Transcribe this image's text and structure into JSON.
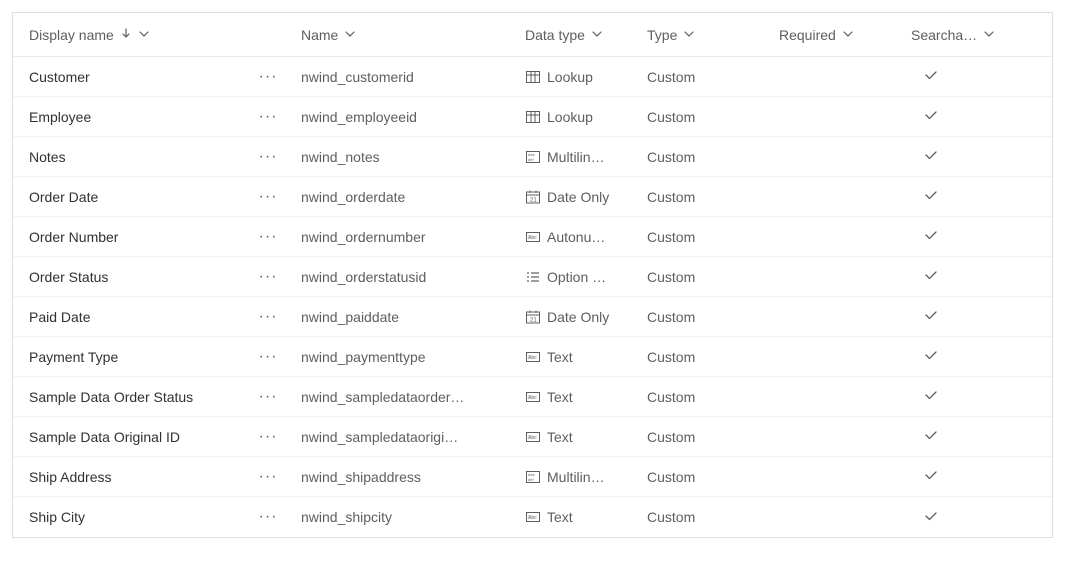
{
  "headers": {
    "display_name": "Display name",
    "name": "Name",
    "data_type": "Data type",
    "type": "Type",
    "required": "Required",
    "searchable": "Searcha…"
  },
  "icons": {
    "more": "···"
  },
  "rows": [
    {
      "display": "Customer",
      "name": "nwind_customerid",
      "datatype_icon": "lookup",
      "datatype": "Lookup",
      "type": "Custom",
      "required": "",
      "searchable": true
    },
    {
      "display": "Employee",
      "name": "nwind_employeeid",
      "datatype_icon": "lookup",
      "datatype": "Lookup",
      "type": "Custom",
      "required": "",
      "searchable": true
    },
    {
      "display": "Notes",
      "name": "nwind_notes",
      "datatype_icon": "multiline",
      "datatype": "Multilin…",
      "type": "Custom",
      "required": "",
      "searchable": true
    },
    {
      "display": "Order Date",
      "name": "nwind_orderdate",
      "datatype_icon": "date",
      "datatype": "Date Only",
      "type": "Custom",
      "required": "",
      "searchable": true
    },
    {
      "display": "Order Number",
      "name": "nwind_ordernumber",
      "datatype_icon": "autonum",
      "datatype": "Autonu…",
      "type": "Custom",
      "required": "",
      "searchable": true
    },
    {
      "display": "Order Status",
      "name": "nwind_orderstatusid",
      "datatype_icon": "option",
      "datatype": "Option …",
      "type": "Custom",
      "required": "",
      "searchable": true
    },
    {
      "display": "Paid Date",
      "name": "nwind_paiddate",
      "datatype_icon": "date",
      "datatype": "Date Only",
      "type": "Custom",
      "required": "",
      "searchable": true
    },
    {
      "display": "Payment Type",
      "name": "nwind_paymenttype",
      "datatype_icon": "text",
      "datatype": "Text",
      "type": "Custom",
      "required": "",
      "searchable": true
    },
    {
      "display": "Sample Data Order Status",
      "name": "nwind_sampledataorder…",
      "datatype_icon": "text",
      "datatype": "Text",
      "type": "Custom",
      "required": "",
      "searchable": true
    },
    {
      "display": "Sample Data Original ID",
      "name": "nwind_sampledataorigi…",
      "datatype_icon": "text",
      "datatype": "Text",
      "type": "Custom",
      "required": "",
      "searchable": true
    },
    {
      "display": "Ship Address",
      "name": "nwind_shipaddress",
      "datatype_icon": "multiline",
      "datatype": "Multilin…",
      "type": "Custom",
      "required": "",
      "searchable": true
    },
    {
      "display": "Ship City",
      "name": "nwind_shipcity",
      "datatype_icon": "text",
      "datatype": "Text",
      "type": "Custom",
      "required": "",
      "searchable": true
    }
  ]
}
